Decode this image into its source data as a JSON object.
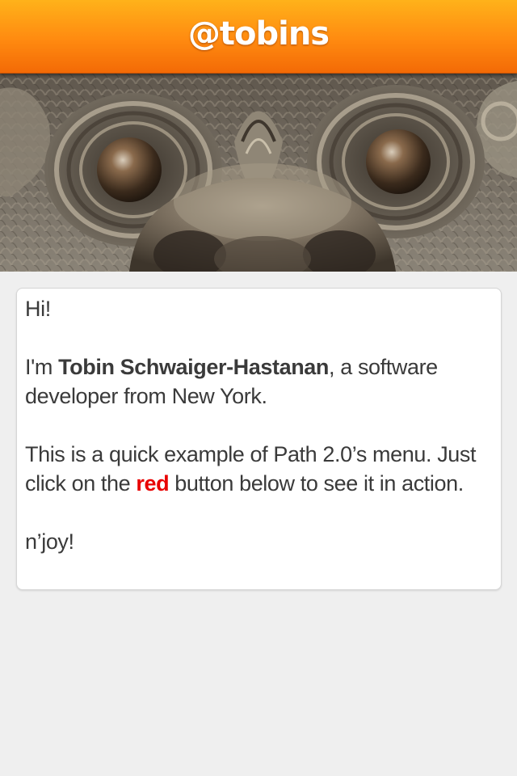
{
  "header": {
    "title": "@tobins"
  },
  "hero": {
    "image_description": "ornate bronze temple sculpture face with round eyes"
  },
  "card": {
    "greeting": "Hi!",
    "intro_prefix": "I'm ",
    "intro_name": "Tobin Schwaiger-Hastanan",
    "intro_suffix": ", a software developer from New York.",
    "example_line": "This is a quick example of Path 2.0’s menu.",
    "instruction_prefix": "Just click on the ",
    "instruction_highlight": "red",
    "instruction_suffix": " button below to see it in action.",
    "signoff": "n’joy!"
  },
  "colors": {
    "header_orange": "#ff8a10",
    "highlight_red": "#e80000",
    "background": "#efefef",
    "text": "#3a3a3a"
  }
}
